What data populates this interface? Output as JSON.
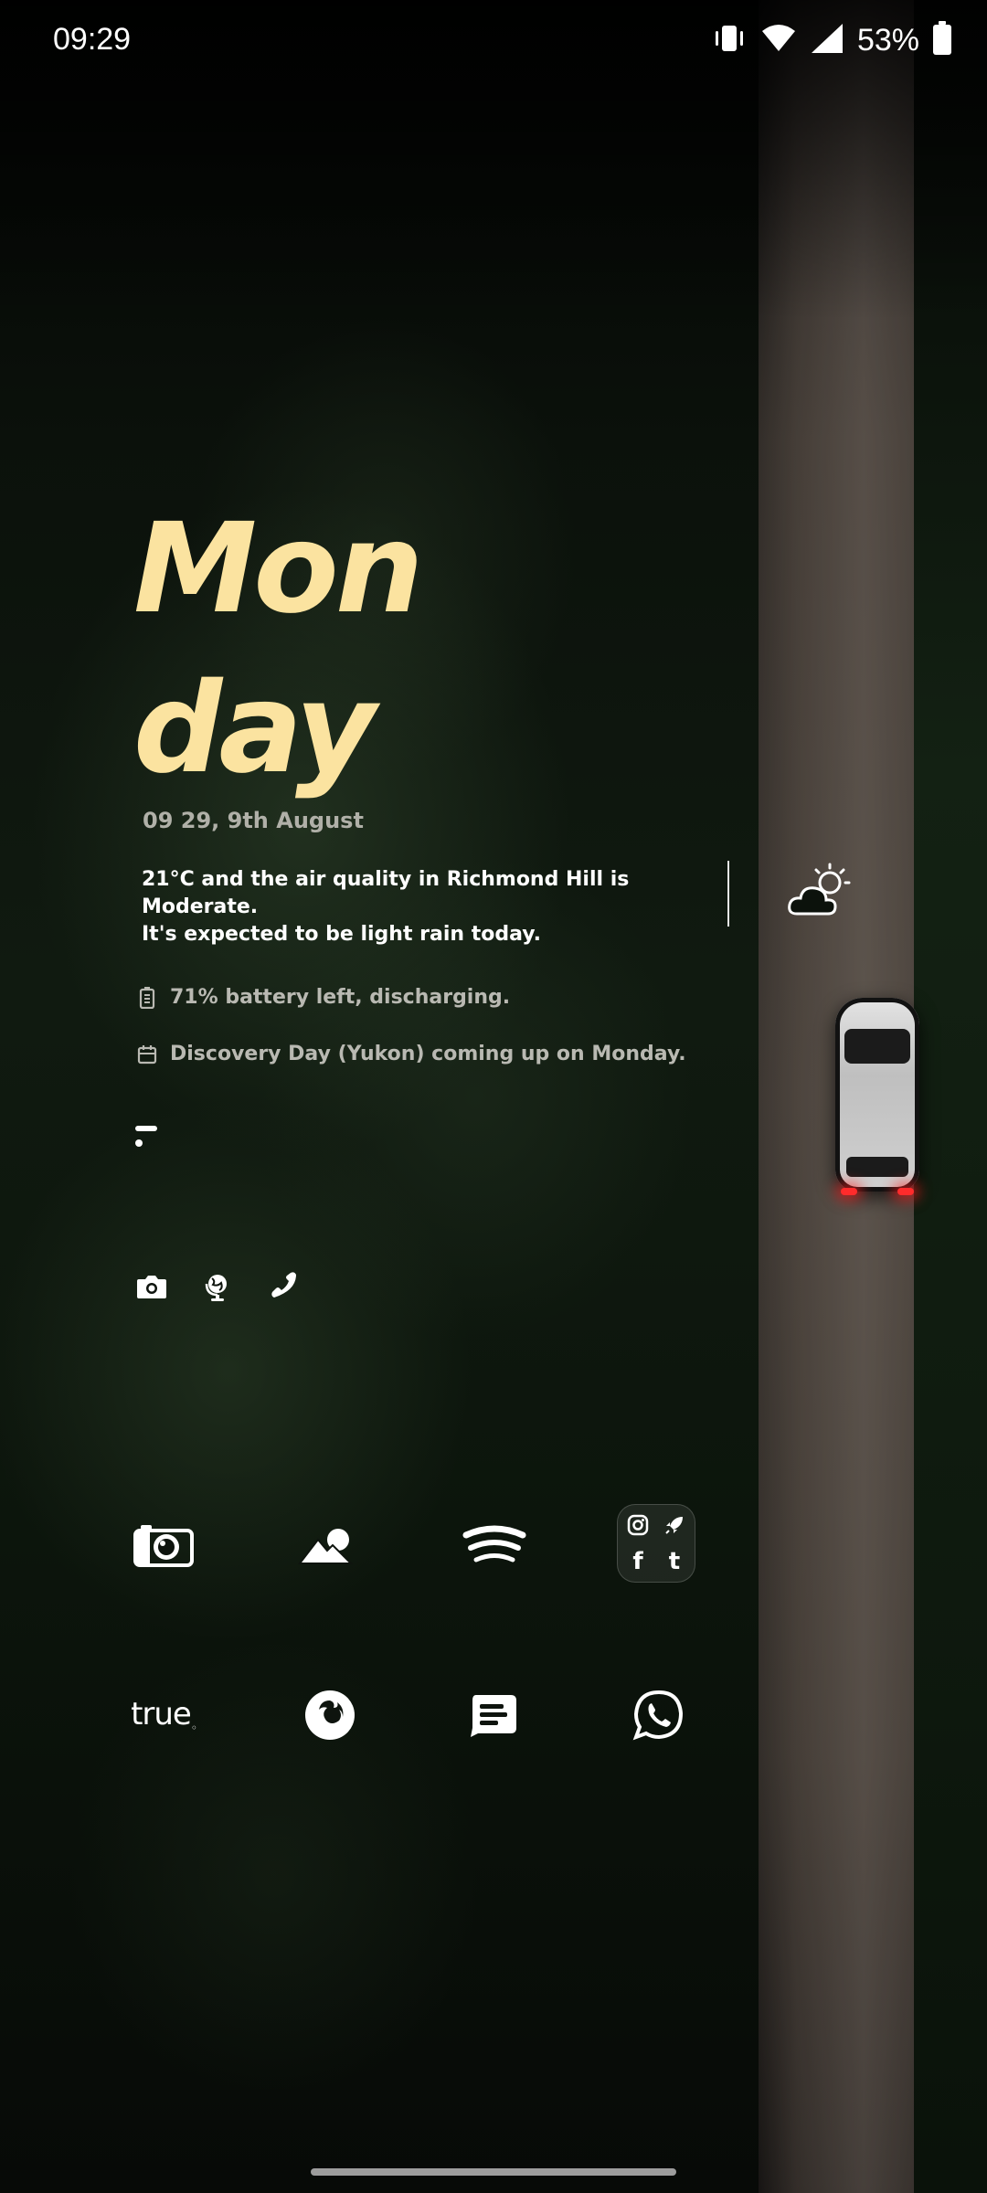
{
  "status_bar": {
    "time": "09:29",
    "battery_percent": "53%",
    "icons": [
      "vibrate-icon",
      "wifi-icon",
      "cell-signal-icon",
      "battery-icon"
    ]
  },
  "widget": {
    "day_part_1": "Mon",
    "day_part_2": "day",
    "date_line": "09 29, 9th August",
    "weather_line_1": "21°C and the air quality in Richmond Hill is Moderate.",
    "weather_line_2": "It's expected to be light rain today.",
    "weather_icon": "partly-cloudy-icon",
    "battery_text": "71% battery left, discharging.",
    "event_text": "Discovery Day (Yukon) coming up on Monday.",
    "quick_actions": [
      "camera-icon",
      "globe-icon",
      "phone-icon"
    ]
  },
  "apps": {
    "row1": [
      "camera-app-icon",
      "gallery-app-icon",
      "spotify-app-icon",
      "social-folder"
    ],
    "folder": {
      "icons": [
        "instagram-icon",
        "rocket-icon",
        "facebook-icon",
        "tumblr-icon"
      ],
      "facebook_letter": "f",
      "tumblr_letter": "t"
    },
    "row2": {
      "true_label": "true",
      "others": [
        "firefox-app-icon",
        "messages-app-icon",
        "whatsapp-app-icon"
      ]
    }
  },
  "colors": {
    "day_accent": "#fbe3a0",
    "muted_text": "#b9b9b2",
    "text": "#ffffff"
  }
}
